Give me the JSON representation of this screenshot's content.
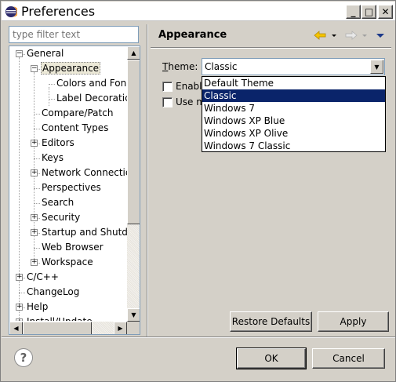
{
  "window": {
    "title": "Preferences",
    "minimize_glyph": "_",
    "maximize_glyph": "□",
    "close_glyph": "✕"
  },
  "left_pane": {
    "filter_placeholder": "type filter text",
    "tree": [
      {
        "label": "General",
        "expander": "−"
      },
      {
        "label": "Appearance",
        "expander": "−",
        "selected": true
      },
      {
        "label": "Colors and Fon",
        "expander": ""
      },
      {
        "label": "Label Decoratic",
        "expander": ""
      },
      {
        "label": "Compare/Patch",
        "expander": ""
      },
      {
        "label": "Content Types",
        "expander": ""
      },
      {
        "label": "Editors",
        "expander": "+"
      },
      {
        "label": "Keys",
        "expander": ""
      },
      {
        "label": "Network Connectic",
        "expander": "+"
      },
      {
        "label": "Perspectives",
        "expander": ""
      },
      {
        "label": "Search",
        "expander": ""
      },
      {
        "label": "Security",
        "expander": "+"
      },
      {
        "label": "Startup and Shutdc",
        "expander": "+"
      },
      {
        "label": "Web Browser",
        "expander": ""
      },
      {
        "label": "Workspace",
        "expander": "+"
      },
      {
        "label": "C/C++",
        "expander": "+"
      },
      {
        "label": "ChangeLog",
        "expander": ""
      },
      {
        "label": "Help",
        "expander": "+"
      },
      {
        "label": "Install/Update",
        "expander": "+"
      }
    ]
  },
  "page": {
    "title": "Appearance",
    "theme_label_prefix": "T",
    "theme_label_rest": "heme:",
    "theme_value": "Classic",
    "dropdown_options": [
      "Default Theme",
      "Classic",
      "Windows 7",
      "Windows XP Blue",
      "Windows XP Olive",
      "Windows 7 Classic"
    ],
    "selected_option": "Classic",
    "checkbox1_label": "Enable animations",
    "checkbox2_label": "Use mixed fonts and colors for labels",
    "restore_defaults_label": "Restore Defaults",
    "apply_label": "Apply"
  },
  "footer": {
    "help_glyph": "?",
    "ok_label": "OK",
    "cancel_label": "Cancel"
  },
  "colors": {
    "selection_bg": "#0a246a",
    "dialog_bg": "#d4d0c8"
  }
}
